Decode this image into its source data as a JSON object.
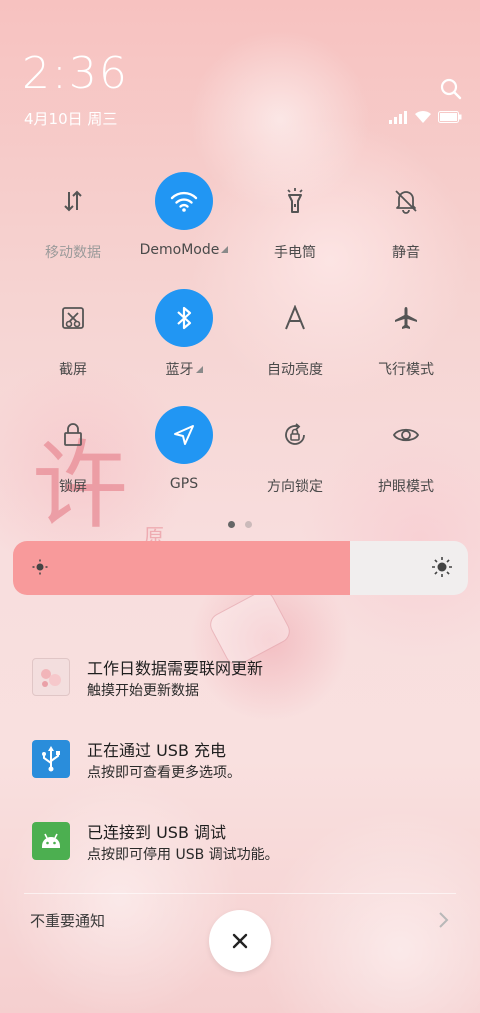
{
  "status": {
    "time": "2:36",
    "date": "4月10日 周三"
  },
  "tiles": [
    {
      "label": "移动数据",
      "icon": "mobile-data-icon",
      "active": false
    },
    {
      "label": "DemoMode",
      "icon": "wifi-icon",
      "active": true
    },
    {
      "label": "手电筒",
      "icon": "flashlight-icon",
      "active": false
    },
    {
      "label": "静音",
      "icon": "mute-bell-icon",
      "active": false
    },
    {
      "label": "截屏",
      "icon": "screenshot-icon",
      "active": false
    },
    {
      "label": "蓝牙",
      "icon": "bluetooth-icon",
      "active": true
    },
    {
      "label": "自动亮度",
      "icon": "auto-brightness-icon",
      "active": false
    },
    {
      "label": "飞行模式",
      "icon": "airplane-icon",
      "active": false
    },
    {
      "label": "锁屏",
      "icon": "lock-icon",
      "active": false
    },
    {
      "label": "GPS",
      "icon": "gps-icon",
      "active": true
    },
    {
      "label": "方向锁定",
      "icon": "rotation-lock-icon",
      "active": false
    },
    {
      "label": "护眼模式",
      "icon": "eye-icon",
      "active": false
    }
  ],
  "brightness": {
    "level": 0.74
  },
  "notifications": [
    {
      "title": "工作日数据需要联网更新",
      "subtitle": "触摸开始更新数据",
      "icon": "calendar-app-icon"
    },
    {
      "title": "正在通过 USB 充电",
      "subtitle": "点按即可查看更多选项。",
      "icon": "usb-icon"
    },
    {
      "title": "已连接到 USB 调试",
      "subtitle": "点按即可停用 USB 调试功能。",
      "icon": "android-icon"
    }
  ],
  "footer": {
    "unimportant_label": "不重要通知"
  },
  "wallpaper": {
    "char_large": "许",
    "char_small": "原"
  },
  "colors": {
    "accent": "#2196f3",
    "brightness_fill": "#f89a9b"
  }
}
